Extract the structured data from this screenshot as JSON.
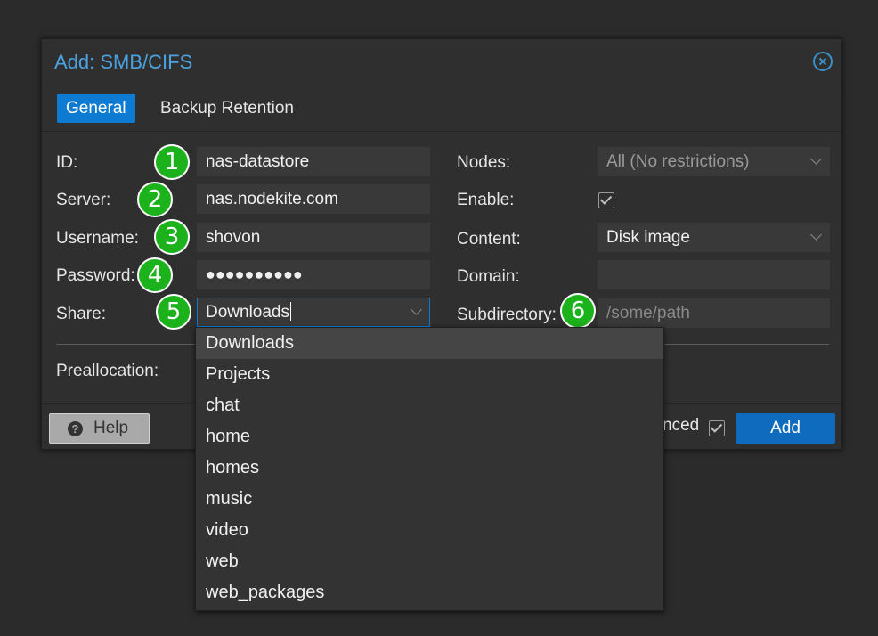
{
  "dialog": {
    "title": "Add: SMB/CIFS",
    "tabs": [
      {
        "label": "General",
        "active": true
      },
      {
        "label": "Backup Retention",
        "active": false
      }
    ]
  },
  "left_fields": {
    "id": {
      "label": "ID:",
      "value": "nas-datastore"
    },
    "server": {
      "label": "Server:",
      "value": "nas.nodekite.com"
    },
    "username": {
      "label": "Username:",
      "value": "shovon"
    },
    "password": {
      "label": "Password:",
      "value": "●●●●●●●●●●"
    },
    "share": {
      "label": "Share:",
      "value": "Downloads"
    }
  },
  "right_fields": {
    "nodes": {
      "label": "Nodes:",
      "value": "All (No restrictions)"
    },
    "enable": {
      "label": "Enable:",
      "checked": true
    },
    "content": {
      "label": "Content:",
      "value": "Disk image"
    },
    "domain": {
      "label": "Domain:",
      "value": ""
    },
    "subdirectory": {
      "label": "Subdirectory:",
      "placeholder": "/some/path"
    }
  },
  "preallocation": {
    "label": "Preallocation:"
  },
  "badges": [
    "1",
    "2",
    "3",
    "4",
    "5",
    "6"
  ],
  "footer": {
    "help_label": "Help",
    "advanced_label": "nced",
    "advanced_checked": true,
    "add_label": "Add"
  },
  "share_dropdown": {
    "options": [
      "Downloads",
      "Projects",
      "chat",
      "home",
      "homes",
      "music",
      "video",
      "web",
      "web_packages"
    ],
    "selected": "Downloads"
  },
  "colors": {
    "accent": "#0e7bd3",
    "title": "#4aa3e0",
    "badge": "#1bb21b",
    "background": "#2b2b2b"
  }
}
